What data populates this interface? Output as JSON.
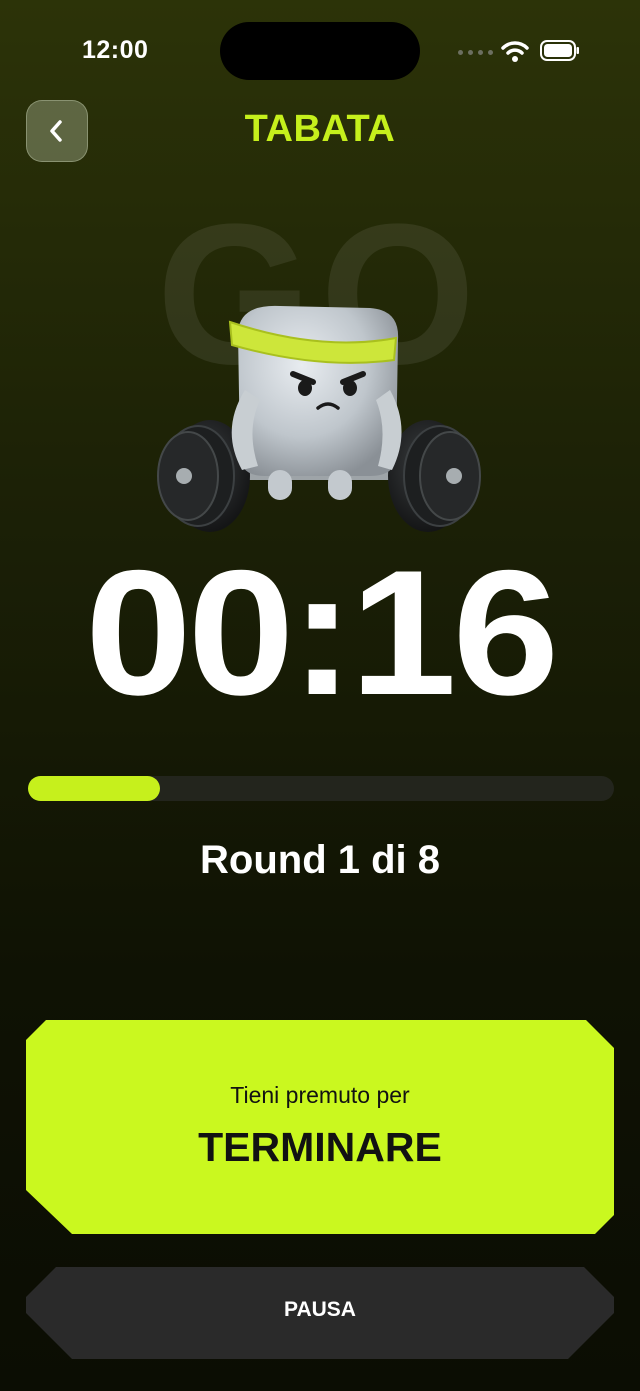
{
  "status_bar": {
    "time": "12:00"
  },
  "header": {
    "title": "TABATA"
  },
  "phase": {
    "label": "GO"
  },
  "timer": {
    "value": "00:16"
  },
  "progress": {
    "fraction": 0.225
  },
  "round": {
    "text": "Round 1 di 8"
  },
  "end_button": {
    "hint": "Tieni premuto per",
    "label": "TERMINARE"
  },
  "pause_button": {
    "label": "PAUSA"
  },
  "colors": {
    "accent": "#c6f01c",
    "button": "#caf81f",
    "pause": "#2a2a2a"
  },
  "icons": {
    "back": "chevron-left-icon",
    "mascot": "weightlifter-mascot"
  }
}
